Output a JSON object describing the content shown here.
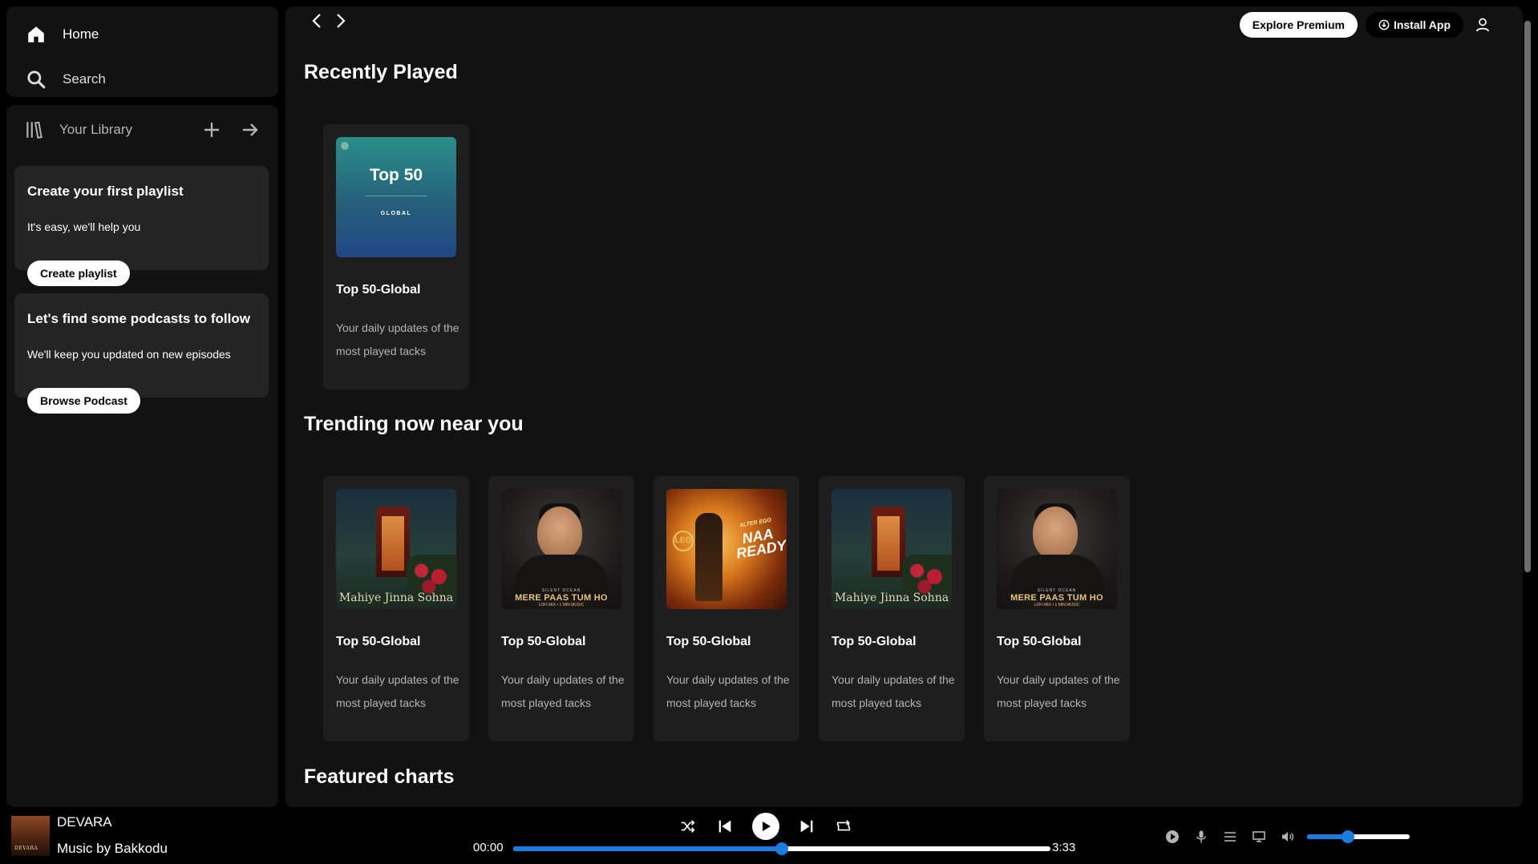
{
  "sidebar": {
    "nav": {
      "home_label": "Home",
      "search_label": "Search"
    },
    "library": {
      "title": "Your Library"
    },
    "promos": [
      {
        "title": "Create your first playlist",
        "text": "It's easy, we'll help you",
        "button": "Create playlist"
      },
      {
        "title": "Let's find some podcasts to follow",
        "text": "We'll keep you updated on new episodes",
        "button": "Browse Podcast"
      }
    ]
  },
  "header": {
    "premium_label": "Explore Premium",
    "install_label": "Install App"
  },
  "sections": {
    "recent": {
      "title": "Recently Played",
      "cards": [
        {
          "title": "Top 50-Global",
          "desc": "Your daily updates of the most played tacks",
          "art": "top50",
          "cover_title": "Top 50",
          "cover_sub": "GLOBAL"
        }
      ]
    },
    "trending": {
      "title": "Trending now near you",
      "cards": [
        {
          "title": "Top 50-Global",
          "desc": "Your daily updates of the most played tacks",
          "art": "booth",
          "cover_title": "Mahiye Jinna Sohna"
        },
        {
          "title": "Top 50-Global",
          "desc": "Your daily updates of the most played tacks",
          "art": "man",
          "cover_top": "SILENT OCEAN",
          "cover_title": "MERE PAAS TUM HO",
          "cover_sub": "LOFI MIX • 1 MIN MUSIC"
        },
        {
          "title": "Top 50-Global",
          "desc": "Your daily updates of the most played tacks",
          "art": "fire",
          "cover_top": "ALTER EGO",
          "cover_title": "NAA READY",
          "cover_badge": "LEO"
        },
        {
          "title": "Top 50-Global",
          "desc": "Your daily updates of the most played tacks",
          "art": "booth",
          "cover_title": "Mahiye Jinna Sohna"
        },
        {
          "title": "Top 50-Global",
          "desc": "Your daily updates of the most played tacks",
          "art": "man",
          "cover_top": "SILENT OCEAN",
          "cover_title": "MERE PAAS TUM HO",
          "cover_sub": "LOFI MIX • 1 MIN MUSIC"
        }
      ]
    },
    "featured": {
      "title": "Featured charts"
    }
  },
  "player": {
    "track_title": "DEVARA",
    "artist": "Music by Bakkodu",
    "time_current": "00:00",
    "time_total": "3:33",
    "progress_percent": 50,
    "volume_percent": 40
  },
  "icons": {
    "home": "home-icon",
    "search": "search-icon",
    "library": "library-icon",
    "plus": "plus-icon",
    "arrow": "arrow-right-icon",
    "shuffle": "shuffle-icon",
    "previous": "previous-icon",
    "play": "play-icon",
    "next": "next-icon",
    "repeat": "repeat-icon",
    "now_playing": "now-playing-icon",
    "mic": "mic-icon",
    "queue": "queue-icon",
    "device": "device-icon",
    "volume": "volume-icon"
  },
  "colors": {
    "accent": "#1a7ee0",
    "surface": "#121212",
    "card": "#1e1e1e",
    "promo": "#242424"
  }
}
